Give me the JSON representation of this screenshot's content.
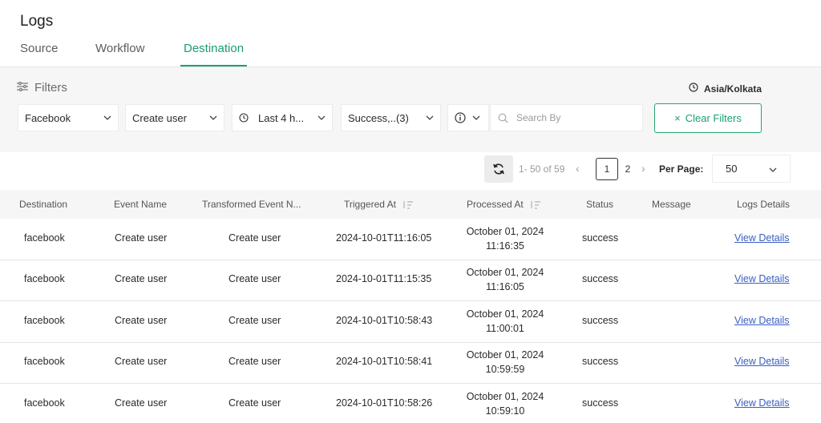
{
  "page": {
    "title": "Logs"
  },
  "tabs": [
    {
      "label": "Source",
      "active": false
    },
    {
      "label": "Workflow",
      "active": false
    },
    {
      "label": "Destination",
      "active": true
    }
  ],
  "filters": {
    "title": "Filters",
    "timezone": "Asia/Kolkata",
    "destination": "Facebook",
    "event": "Create user",
    "time_range": "Last 4 h...",
    "status": "Success,..(3)",
    "search_placeholder": "Search By",
    "clear_label": "Clear Filters"
  },
  "pagination": {
    "range": "1- 50 of 59",
    "pages": [
      "1",
      "2"
    ],
    "current_page": "1",
    "per_page_label": "Per Page:",
    "per_page_value": "50"
  },
  "table": {
    "headers": [
      "Destination",
      "Event Name",
      "Transformed Event N...",
      "Triggered At",
      "Processed At",
      "Status",
      "Message",
      "Logs Details"
    ],
    "rows": [
      {
        "destination": "facebook",
        "event": "Create user",
        "transformed": "Create user",
        "triggered": "2024-10-01T11:16:05",
        "processed_date": "October 01, 2024",
        "processed_time": "11:16:35",
        "status": "success",
        "message": "",
        "details": "View Details"
      },
      {
        "destination": "facebook",
        "event": "Create user",
        "transformed": "Create user",
        "triggered": "2024-10-01T11:15:35",
        "processed_date": "October 01, 2024",
        "processed_time": "11:16:05",
        "status": "success",
        "message": "",
        "details": "View Details"
      },
      {
        "destination": "facebook",
        "event": "Create user",
        "transformed": "Create user",
        "triggered": "2024-10-01T10:58:43",
        "processed_date": "October 01, 2024",
        "processed_time": "11:00:01",
        "status": "success",
        "message": "",
        "details": "View Details"
      },
      {
        "destination": "facebook",
        "event": "Create user",
        "transformed": "Create user",
        "triggered": "2024-10-01T10:58:41",
        "processed_date": "October 01, 2024",
        "processed_time": "10:59:59",
        "status": "success",
        "message": "",
        "details": "View Details"
      },
      {
        "destination": "facebook",
        "event": "Create user",
        "transformed": "Create user",
        "triggered": "2024-10-01T10:58:26",
        "processed_date": "October 01, 2024",
        "processed_time": "10:59:10",
        "status": "success",
        "message": "",
        "details": "View Details"
      }
    ]
  },
  "colors": {
    "accent": "#1aa06d",
    "link": "#3a5ec2",
    "panel": "#f6f6f6"
  }
}
